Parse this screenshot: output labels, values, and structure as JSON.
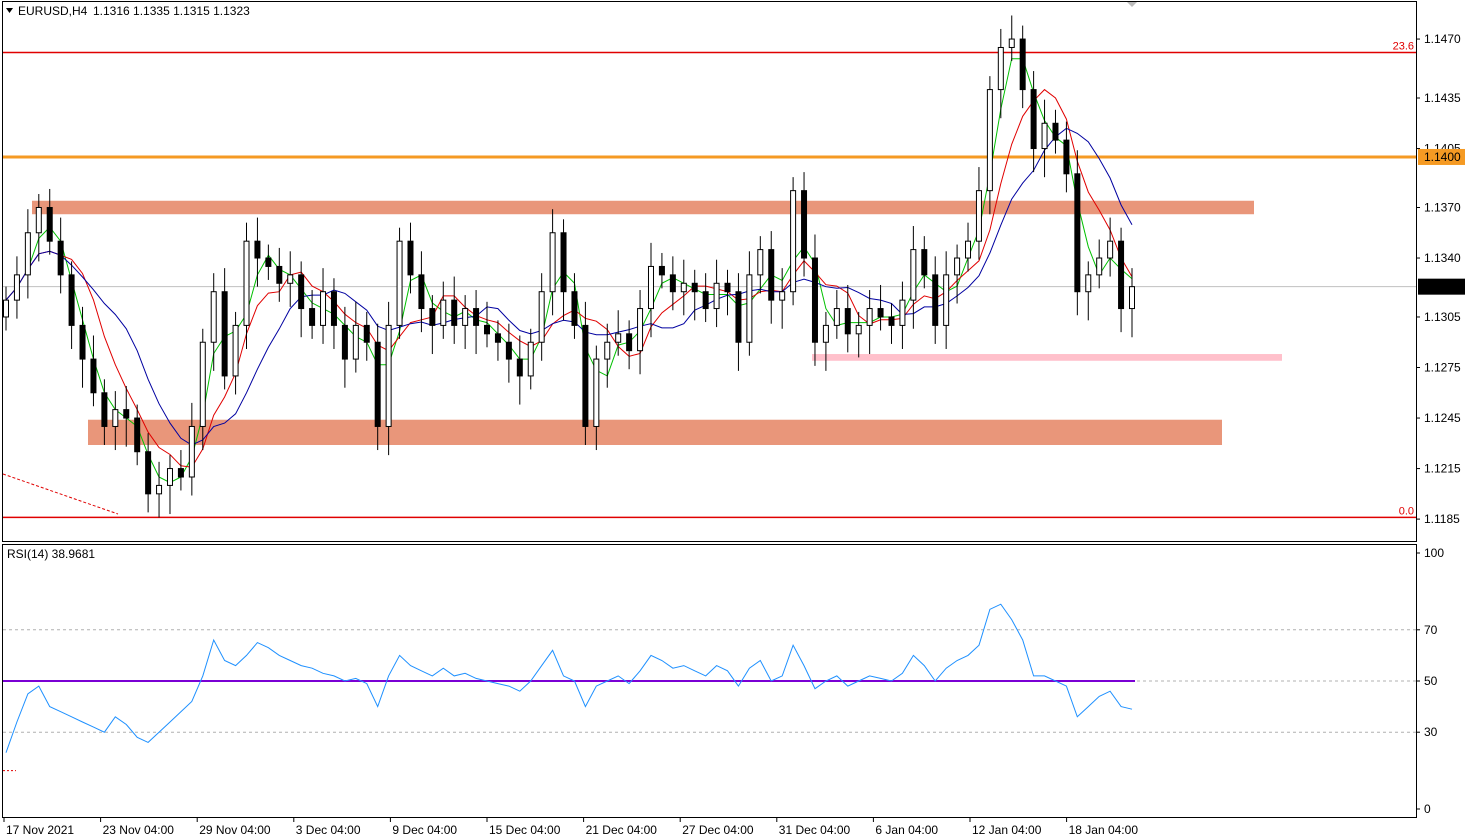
{
  "chart_data": {
    "type": "candlestick",
    "header": {
      "symbol": "EURUSD,H4",
      "ohlc": "1.1316 1.1335 1.1315 1.1323"
    },
    "price_axis": {
      "ylim": [
        1.1172,
        1.1492
      ],
      "ticks": [
        "1.1470",
        "1.1435",
        "1.1405",
        "1.1370",
        "1.1340",
        "1.1305",
        "1.1275",
        "1.1245",
        "1.1215",
        "1.1185"
      ],
      "current_price_label": "1.1323",
      "current_price": 1.1323,
      "level_label_1400": "1.1400"
    },
    "time_axis": {
      "labels": [
        "17 Nov 2021",
        "23 Nov 04:00",
        "29 Nov 04:00",
        "3 Dec 04:00",
        "9 Dec 04:00",
        "15 Dec 04:00",
        "21 Dec 04:00",
        "27 Dec 04:00",
        "31 Dec 04:00",
        "6 Jan 04:00",
        "12 Jan 04:00",
        "18 Jan 04:00"
      ]
    },
    "levels": [
      {
        "label": "23.6",
        "price": 1.1462,
        "color": "#e00000"
      },
      {
        "label": "0.0",
        "price": 1.1186,
        "color": "#e00000"
      },
      {
        "label": "",
        "price": 1.14,
        "color": "#f59a23"
      }
    ],
    "zones": [
      {
        "from": 1.1366,
        "to": 1.1374,
        "color": "#e9967a"
      },
      {
        "from": 1.1229,
        "to": 1.1244,
        "color": "#e9967a"
      },
      {
        "from": 1.1279,
        "to": 1.1283,
        "color": "#ffc0cb"
      }
    ],
    "closes": [
      1.1315,
      1.133,
      1.1355,
      1.137,
      1.135,
      1.133,
      1.13,
      1.128,
      1.126,
      1.124,
      1.125,
      1.1245,
      1.1225,
      1.12,
      1.1205,
      1.1215,
      1.121,
      1.124,
      1.129,
      1.132,
      1.127,
      1.13,
      1.135,
      1.134,
      1.1335,
      1.1325,
      1.133,
      1.131,
      1.13,
      1.132,
      1.13,
      1.128,
      1.13,
      1.129,
      1.124,
      1.13,
      1.135,
      1.133,
      1.131,
      1.13,
      1.1315,
      1.13,
      1.131,
      1.13,
      1.1295,
      1.129,
      1.128,
      1.127,
      1.129,
      1.132,
      1.1355,
      1.132,
      1.13,
      1.124,
      1.128,
      1.129,
      1.1295,
      1.1285,
      1.131,
      1.1335,
      1.133,
      1.132,
      1.1325,
      1.132,
      1.131,
      1.1325,
      1.132,
      1.129,
      1.133,
      1.1345,
      1.1315,
      1.132,
      1.138,
      1.134,
      1.129,
      1.13,
      1.131,
      1.1295,
      1.13,
      1.131,
      1.1305,
      1.13,
      1.1315,
      1.1345,
      1.133,
      1.13,
      1.133,
      1.134,
      1.135,
      1.138,
      1.144,
      1.1465,
      1.147,
      1.144,
      1.1405,
      1.142,
      1.141,
      1.139,
      1.132,
      1.133,
      1.134,
      1.135,
      1.131,
      1.1323
    ],
    "indicator": {
      "label": "RSI(14) 38.9681",
      "ylim": [
        0,
        100
      ],
      "ticks": [
        "100",
        "70",
        "50",
        "30",
        "0"
      ],
      "levels": [
        70,
        50,
        30
      ],
      "values": [
        22,
        34,
        45,
        48,
        40,
        38,
        36,
        34,
        32,
        30,
        36,
        33,
        28,
        26,
        30,
        34,
        38,
        42,
        52,
        66,
        58,
        56,
        60,
        65,
        63,
        60,
        58,
        56,
        55,
        53,
        52,
        50,
        51,
        49,
        40,
        52,
        60,
        56,
        54,
        52,
        55,
        52,
        53,
        51,
        50,
        49,
        48,
        46,
        50,
        56,
        62,
        52,
        50,
        40,
        48,
        50,
        52,
        49,
        54,
        60,
        58,
        55,
        56,
        54,
        52,
        56,
        54,
        48,
        55,
        58,
        50,
        52,
        64,
        56,
        47,
        50,
        52,
        48,
        50,
        52,
        51,
        50,
        53,
        60,
        56,
        50,
        55,
        58,
        60,
        64,
        78,
        80,
        74,
        66,
        52,
        52,
        50,
        48,
        36,
        40,
        44,
        46,
        40,
        39
      ]
    }
  }
}
